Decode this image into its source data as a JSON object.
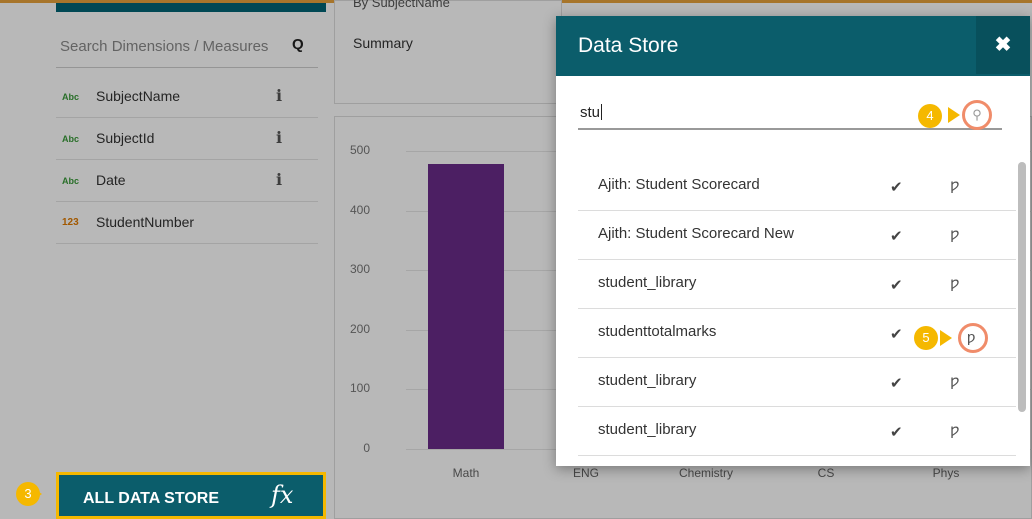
{
  "left_panel": {
    "search_placeholder": "Search Dimensions / Measures",
    "fields": [
      {
        "type": "Abc",
        "name": "SubjectName",
        "info": "i"
      },
      {
        "type": "Abc",
        "name": "SubjectId",
        "info": "i"
      },
      {
        "type": "Abc",
        "name": "Date",
        "info": "i"
      },
      {
        "type": "123",
        "name": "StudentNumber",
        "info": ""
      }
    ],
    "all_data_store_label": "ALL DATA STORE",
    "fx_symbol": "fx"
  },
  "summary": {
    "top_text": "By SubjectName",
    "label": "Summary"
  },
  "chart_data": {
    "type": "bar",
    "categories": [
      "Math",
      "ENG",
      "Chemistry",
      "CS",
      "Phys"
    ],
    "values": [
      478,
      null,
      null,
      null,
      null
    ],
    "ylim": [
      0,
      500
    ],
    "yticks": [
      "0",
      "100",
      "200",
      "300",
      "400",
      "500"
    ],
    "color": "#6a2c8a"
  },
  "modal": {
    "title": "Data Store",
    "close_symbol": "✖",
    "search_value": "stu",
    "items": [
      {
        "name": "Ajith: Student Scorecard"
      },
      {
        "name": "Ajith: Student Scorecard New"
      },
      {
        "name": "student_library"
      },
      {
        "name": "studenttotalmarks"
      },
      {
        "name": "student_library"
      },
      {
        "name": "student_library"
      }
    ],
    "check_symbol": "✔",
    "fork_symbol": "ƿ"
  },
  "steps": {
    "three": "3",
    "four": "4",
    "five": "5"
  },
  "colors": {
    "accent": "#0b5d6b",
    "highlight": "#f5b800",
    "ring": "#f08c6a"
  }
}
